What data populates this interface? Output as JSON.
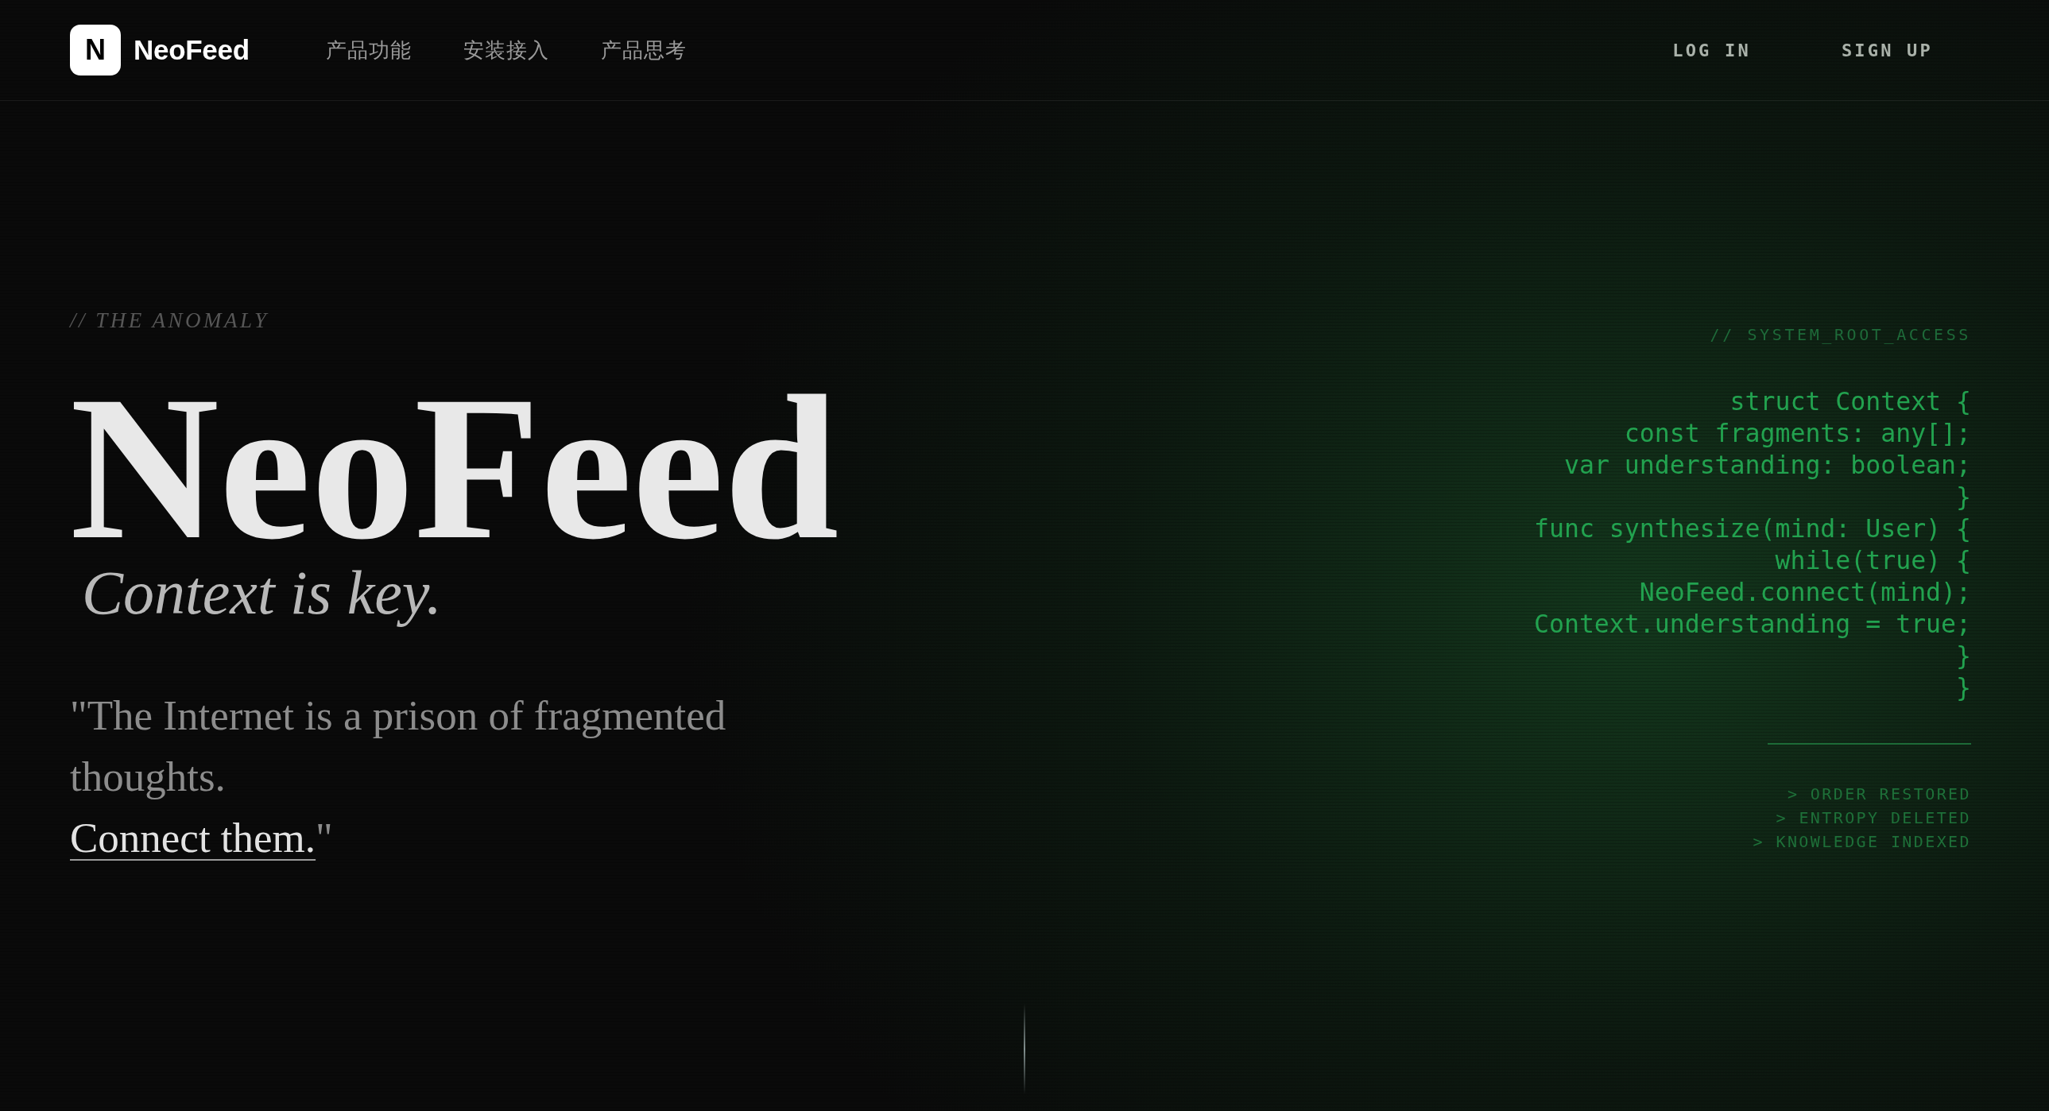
{
  "header": {
    "logo": {
      "mark": "N",
      "name": "NeoFeed"
    },
    "nav": [
      "产品功能",
      "安装接入",
      "产品思考"
    ],
    "actions": [
      "LOG IN",
      "SIGN UP"
    ]
  },
  "hero": {
    "eyebrow": "// THE ANOMALY",
    "title": "NeoFeed",
    "subtitle": "Context is key.",
    "quote": {
      "text": "\"The Internet is a prison of fragmented thoughts.",
      "emphasis": "Connect them.",
      "closing": "\""
    }
  },
  "terminal": {
    "header": "// SYSTEM_ROOT_ACCESS",
    "code_lines": [
      "struct Context {",
      "const fragments: any[];",
      "var understanding: boolean;",
      "}",
      "func synthesize(mind: User) {",
      "while(true) {",
      "NeoFeed.connect(mind);",
      "Context.understanding = true;",
      "}",
      "}"
    ],
    "log": [
      "> ORDER RESTORED",
      "> ENTROPY DELETED",
      "> KNOWLEDGE INDEXED"
    ]
  }
}
